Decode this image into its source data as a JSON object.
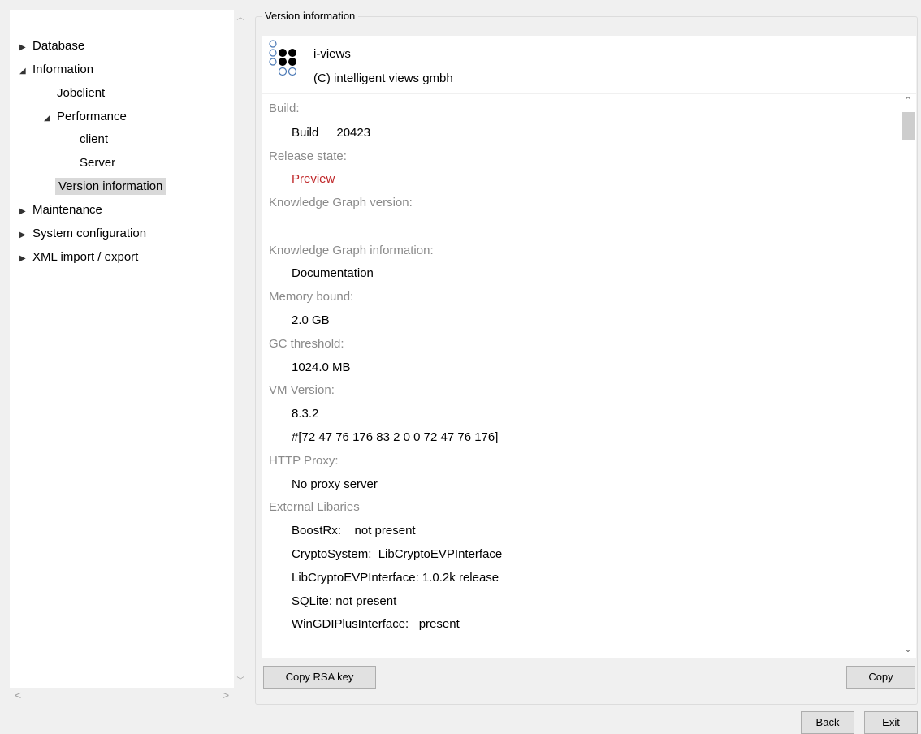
{
  "tree": {
    "items": [
      {
        "label": "Database"
      },
      {
        "label": "Information"
      },
      {
        "label": "Jobclient"
      },
      {
        "label": "Performance"
      },
      {
        "label": "client"
      },
      {
        "label": "Server"
      },
      {
        "label": "Version information"
      },
      {
        "label": "Maintenance"
      },
      {
        "label": "System configuration"
      },
      {
        "label": "XML import / export"
      }
    ]
  },
  "group": {
    "title": "Version information"
  },
  "header": {
    "product": "i-views",
    "copyright": "(C) intelligent views gmbh"
  },
  "info": {
    "build_label": "Build:",
    "build_name": "Build",
    "build_number": "20423",
    "release_label": "Release state:",
    "release_value": "Preview",
    "kg_version_label": "Knowledge Graph version:",
    "kg_info_label": "Knowledge Graph information:",
    "kg_info_value": "Documentation",
    "memory_label": "Memory bound:",
    "memory_value": "2.0 GB",
    "gc_label": "GC threshold:",
    "gc_value": "1024.0 MB",
    "vm_label": "VM Version:",
    "vm_value": "8.3.2",
    "vm_bytes": "#[72 47 76 176 83 2 0 0 72 47 76 176]",
    "proxy_label": "HTTP Proxy:",
    "proxy_value": "No proxy server",
    "libs_label": "External Libaries",
    "libs": [
      "BoostRx:    not present",
      "CryptoSystem:  LibCryptoEVPInterface",
      "LibCryptoEVPInterface: 1.0.2k release",
      "SQLite: not present",
      "WinGDIPlusInterface:   present"
    ]
  },
  "buttons": {
    "copy_rsa": "Copy RSA key",
    "copy": "Copy",
    "back": "Back",
    "exit": "Exit"
  },
  "colors": {
    "preview": "#c0282a",
    "selection": "#d9d9d9"
  }
}
